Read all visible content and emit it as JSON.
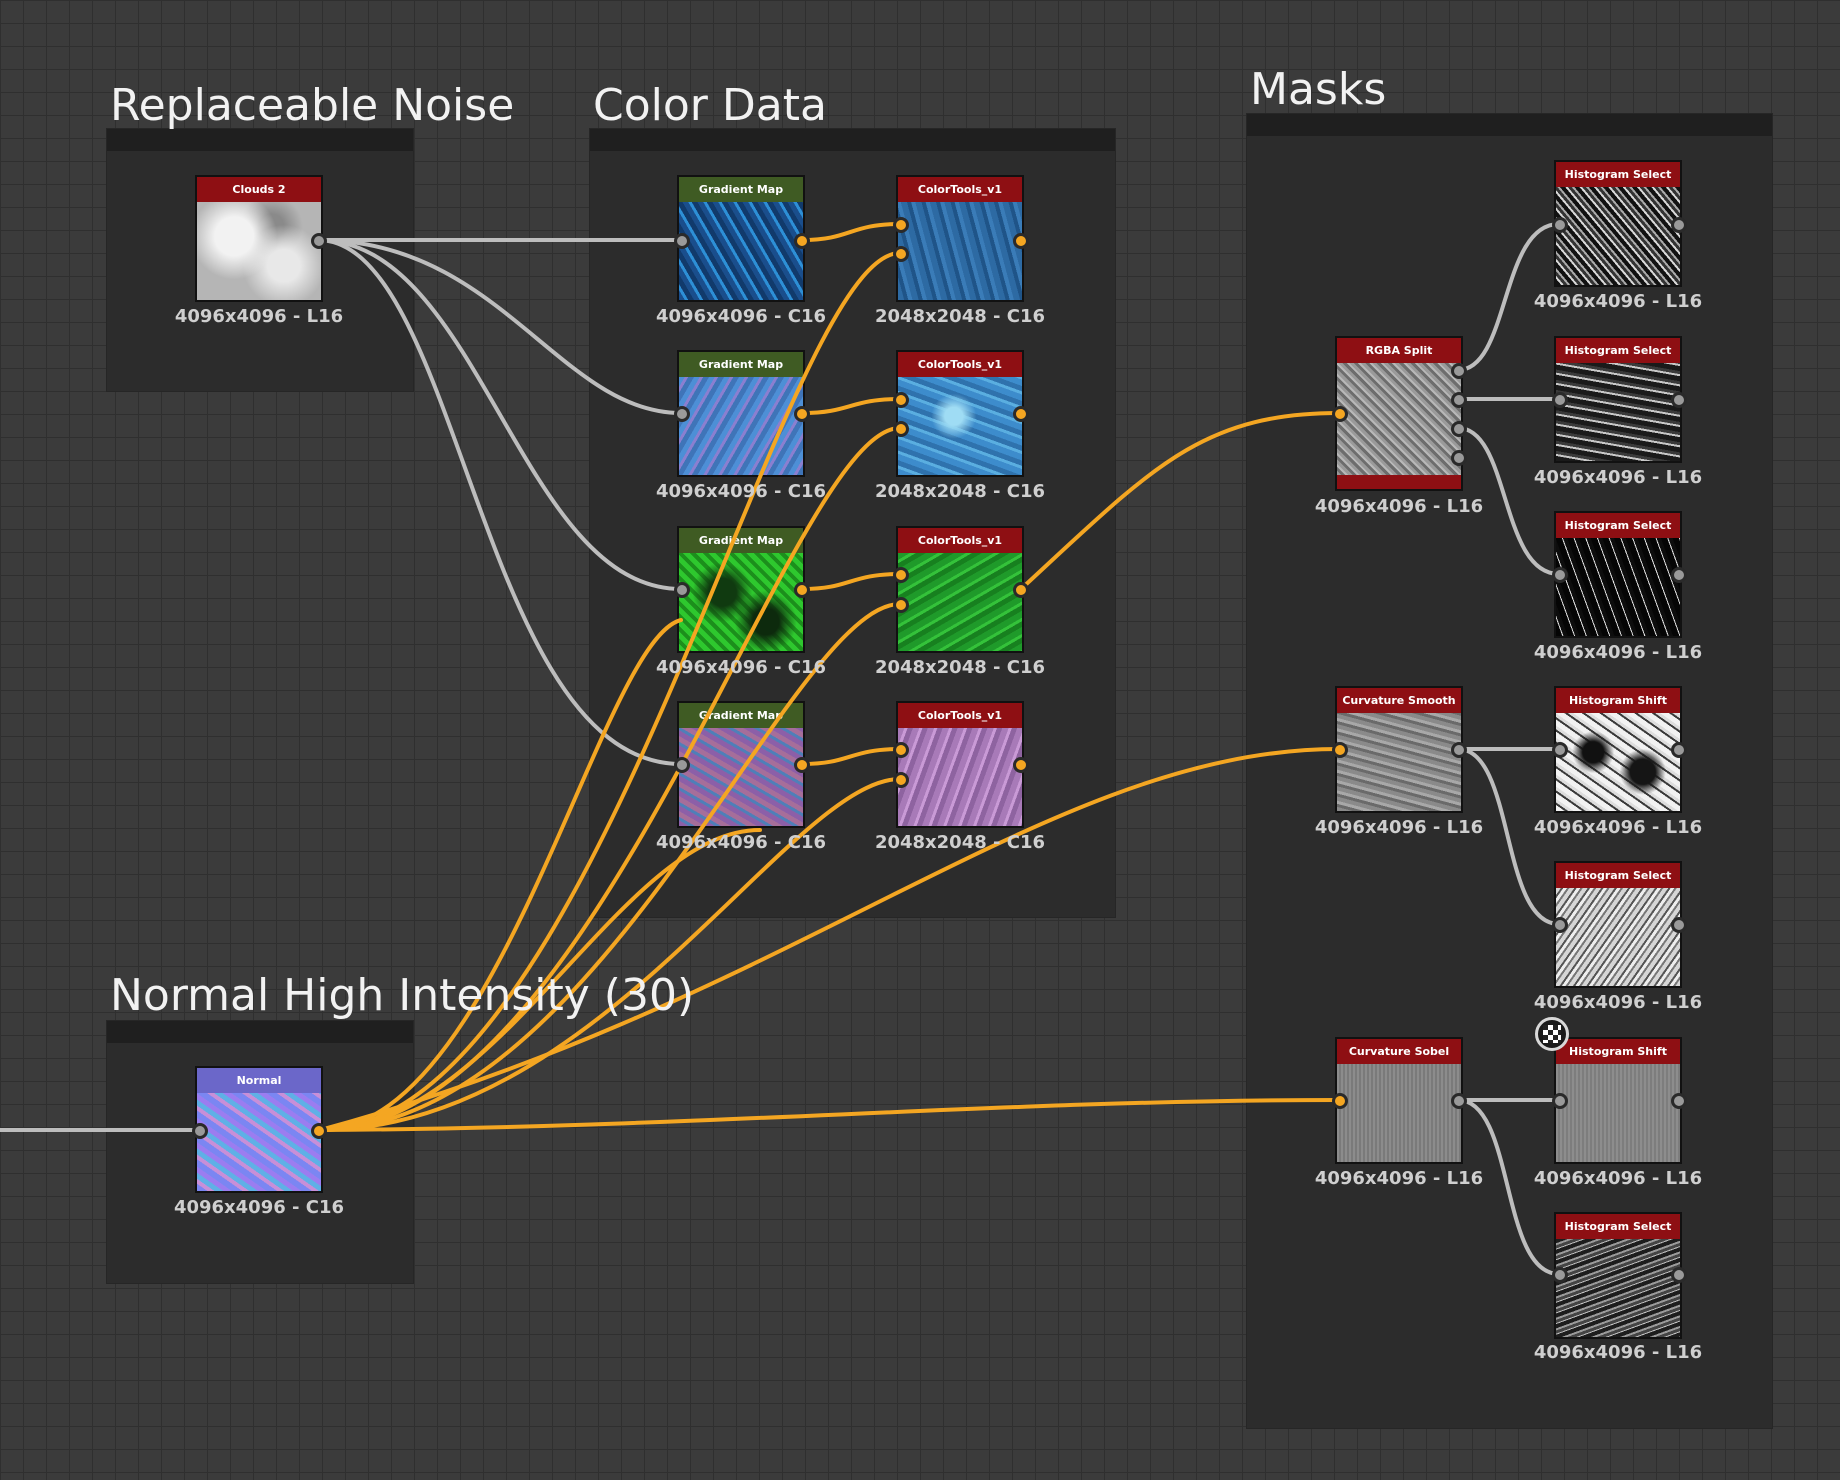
{
  "frames": {
    "replaceable_noise": "Replaceable Noise",
    "color_data": "Color Data",
    "masks": "Masks",
    "normal_high_intensity": "Normal High Intensity (30)"
  },
  "nodes": {
    "clouds2": {
      "title": "Clouds 2",
      "res": "4096x4096 - L16"
    },
    "normal": {
      "title": "Normal",
      "res": "4096x4096 - C16"
    },
    "grad1": {
      "title": "Gradient Map",
      "res": "4096x4096 - C16"
    },
    "grad2": {
      "title": "Gradient Map",
      "res": "4096x4096 - C16"
    },
    "grad3": {
      "title": "Gradient Map",
      "res": "4096x4096 - C16"
    },
    "grad4": {
      "title": "Gradient Map",
      "res": "4096x4096 - C16"
    },
    "ct1": {
      "title": "ColorTools_v1",
      "res": "2048x2048 - C16"
    },
    "ct2": {
      "title": "ColorTools_v1",
      "res": "2048x2048 - C16"
    },
    "ct3": {
      "title": "ColorTools_v1",
      "res": "2048x2048 - C16"
    },
    "ct4": {
      "title": "ColorTools_v1",
      "res": "2048x2048 - C16"
    },
    "rgba": {
      "title": "RGBA Split",
      "res": "4096x4096 - L16"
    },
    "curvsmooth": {
      "title": "Curvature Smooth",
      "res": "4096x4096 - L16"
    },
    "curvsobel": {
      "title": "Curvature Sobel",
      "res": "4096x4096 - L16"
    },
    "hs1": {
      "title": "Histogram Select",
      "res": "4096x4096 - L16"
    },
    "hs2": {
      "title": "Histogram Select",
      "res": "4096x4096 - L16"
    },
    "hs3": {
      "title": "Histogram Select",
      "res": "4096x4096 - L16"
    },
    "hsh1": {
      "title": "Histogram Shift",
      "res": "4096x4096 - L16"
    },
    "hs4": {
      "title": "Histogram Select",
      "res": "4096x4096 - L16"
    },
    "hsh2": {
      "title": "Histogram Shift",
      "res": "4096x4096 - L16"
    },
    "hs5": {
      "title": "Histogram Select",
      "res": "4096x4096 - L16"
    }
  },
  "colors": {
    "canvas": "#3b3b3b",
    "frame": "#2c2c2c",
    "header_red": "#8e0f13",
    "header_green": "#3f5b23",
    "header_blue": "#6b67c9",
    "wire_gray": "#bdbdbd",
    "wire_orange": "#f4a622"
  },
  "icons": {
    "output_preview": "checker-badge-icon"
  }
}
